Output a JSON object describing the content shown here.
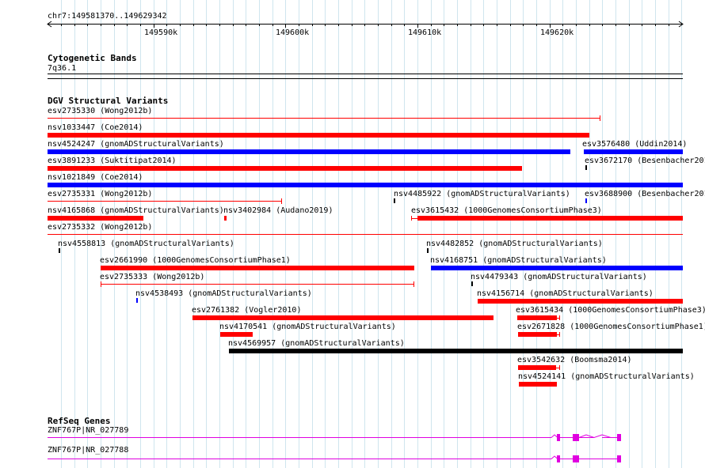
{
  "ruler": {
    "location": "chr7:149581370..149629342",
    "ticks": [
      "149590k",
      "149600k",
      "149610k",
      "149620k"
    ]
  },
  "cytogenetic": {
    "title": "Cytogenetic Bands",
    "band": "7q36.1"
  },
  "dgv": {
    "title": "DGV Structural Variants",
    "features": [
      "esv2735330 (Wong2012b)",
      "nsv1033447 (Coe2014)",
      "nsv4524247 (gnomADStructuralVariants)",
      "esv3576480 (Uddin2014)",
      "esv3891233 (Suktitipat2014)",
      "esv3672170 (Besenbacher2016)",
      "nsv1021849 (Coe2014)",
      "esv2735331 (Wong2012b)",
      "nsv4485922 (gnomADStructuralVariants)",
      "esv3688900 (Besenbacher2016)",
      "nsv4165868 (gnomADStructuralVariants)",
      "nsv3402984 (Audano2019)",
      "esv3615432 (1000GenomesConsortiumPhase3)",
      "esv2735332 (Wong2012b)",
      "nsv4558813 (gnomADStructuralVariants)",
      "nsv4482852 (gnomADStructuralVariants)",
      "esv2661990 (1000GenomesConsortiumPhase1)",
      "nsv4168751 (gnomADStructuralVariants)",
      "esv2735333 (Wong2012b)",
      "nsv4479343 (gnomADStructuralVariants)",
      "nsv4538493 (gnomADStructuralVariants)",
      "nsv4156714 (gnomADStructuralVariants)",
      "esv2761382 (Vogler2010)",
      "esv3615434 (1000GenomesConsortiumPhase3)",
      "nsv4170541 (gnomADStructuralVariants)",
      "esv2671828 (1000GenomesConsortiumPhase1)",
      "nsv4569957 (gnomADStructuralVariants)",
      "esv3542632 (Boomsma2014)",
      "nsv4524141 (gnomADStructuralVariants)"
    ]
  },
  "refseq": {
    "title": "RefSeq Genes",
    "genes": [
      "ZNF767P|NR_027789",
      "ZNF767P|NR_027788"
    ]
  },
  "colors": {
    "gain": "#ff0000",
    "loss": "#0000ff",
    "complex": "#000000",
    "gene": "#e000e0",
    "grid": "#cfe5ee"
  }
}
